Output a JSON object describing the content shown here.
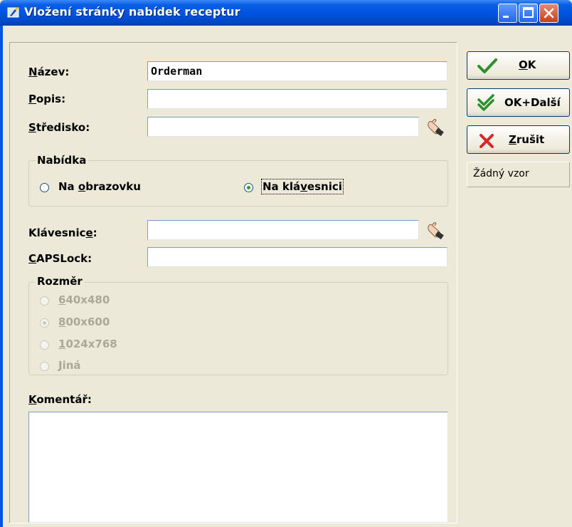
{
  "window": {
    "title": "Vložení stránky nabídek receptur"
  },
  "form": {
    "nazev": {
      "label_u": "N",
      "label_rest": "ázev:",
      "value": "Orderman"
    },
    "popis": {
      "label_u": "P",
      "label_rest": "opis:",
      "value": ""
    },
    "stredisko": {
      "label_u": "S",
      "label_rest": "tředisko:",
      "value": ""
    },
    "nabidka": {
      "legend": "Nabídka",
      "option1": {
        "pre": "Na ",
        "u": "o",
        "post": "brazovku"
      },
      "option2": {
        "pre": "Na klá",
        "u": "v",
        "post": "esnici"
      },
      "selected": "Na klávesnici"
    },
    "klavesnice": {
      "label_pre": "Klávesnic",
      "label_u": "e",
      "label_post": ":",
      "value": ""
    },
    "capslock": {
      "label_u": "C",
      "label_rest": "APSLock:",
      "value": ""
    },
    "rozmer": {
      "legend": "Rozměr",
      "options": [
        {
          "u": "6",
          "rest": "40x480"
        },
        {
          "u": "8",
          "rest": "00x600"
        },
        {
          "u": "1",
          "rest": "024x768"
        },
        {
          "u": "J",
          "rest": "iná"
        }
      ],
      "selected": "800x600"
    },
    "komentar": {
      "label_u": "K",
      "label_rest": "omentář:",
      "value": ""
    }
  },
  "buttons": {
    "ok": {
      "u": "O",
      "rest": "K"
    },
    "ok_dalsi": {
      "label": "OK+Další"
    },
    "zrusit": {
      "u": "Z",
      "rest": "rušit"
    },
    "zadny_vzor": {
      "label": "Žádný vzor"
    }
  },
  "colors": {
    "titlebar": "#0054e3",
    "check_green": "#2f8f2f",
    "cancel_red": "#d8262a",
    "face": "#ece9d8"
  }
}
